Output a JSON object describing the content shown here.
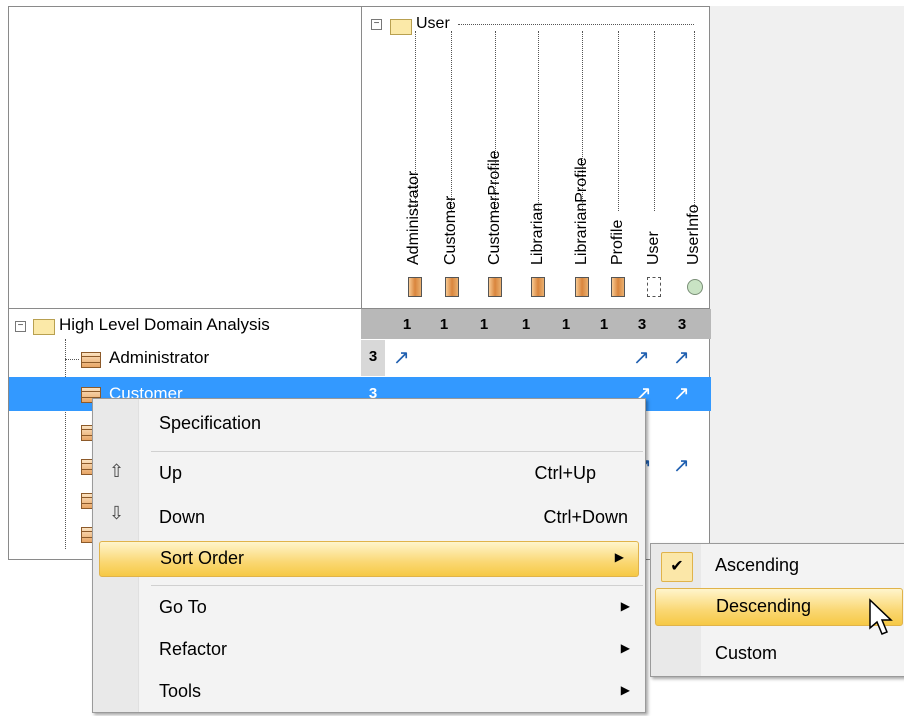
{
  "column_group": {
    "label": "User"
  },
  "columns": [
    {
      "label": "Administrator",
      "icon": "class-icon"
    },
    {
      "label": "Customer",
      "icon": "class-icon"
    },
    {
      "label": "CustomerProfile",
      "icon": "class-icon"
    },
    {
      "label": "Librarian",
      "icon": "class-icon"
    },
    {
      "label": "LibrarianProfile",
      "icon": "class-icon"
    },
    {
      "label": "Profile",
      "icon": "class-icon"
    },
    {
      "label": "User",
      "icon": "interface-icon"
    },
    {
      "label": "UserInfo",
      "icon": "circle-icon"
    }
  ],
  "column_counts": [
    "1",
    "1",
    "1",
    "1",
    "1",
    "1",
    "3",
    "3"
  ],
  "row_group": {
    "label": "High Level Domain Analysis"
  },
  "rows": [
    {
      "label": "Administrator",
      "count": "3"
    },
    {
      "label": "Customer",
      "count": "3"
    }
  ],
  "context_menu": {
    "specification": "Specification",
    "up": "Up",
    "up_shortcut": "Ctrl+Up",
    "down": "Down",
    "down_shortcut": "Ctrl+Down",
    "sort_order": "Sort Order",
    "go_to": "Go To",
    "refactor": "Refactor",
    "tools": "Tools"
  },
  "sort_submenu": {
    "ascending": "Ascending",
    "descending": "Descending",
    "custom": "Custom",
    "checked": "Ascending"
  },
  "colors": {
    "selection": "#3399ff",
    "highlight": "#fad772",
    "arrow": "#1f5fb0"
  }
}
